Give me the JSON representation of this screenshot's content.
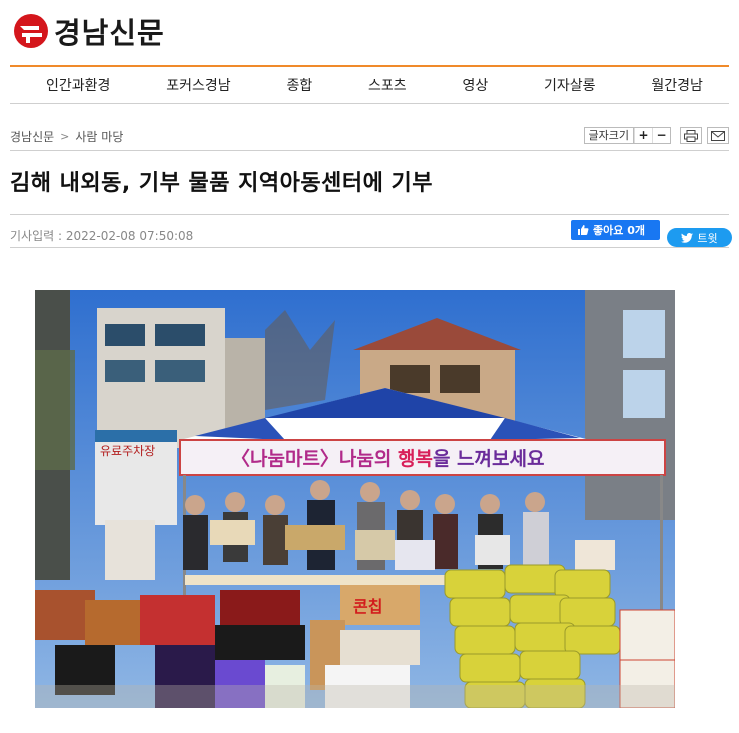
{
  "site": {
    "logo_text": "경남신문"
  },
  "nav": {
    "items": [
      "인간과환경",
      "포커스경남",
      "종합",
      "스포츠",
      "영상",
      "기자살롱",
      "월간경남"
    ]
  },
  "breadcrumb": {
    "home": "경남신문",
    "separator": ">",
    "section": "사람 마당"
  },
  "tools": {
    "font_size_label": "글자크기",
    "plus": "+",
    "minus": "−"
  },
  "article": {
    "title": "김해 내외동, 기부 물품 지역아동센터에 기부",
    "date_label": "기사입력 : 2022-02-08 07:50:08"
  },
  "social": {
    "like_label": "좋아요 0개",
    "tweet_label": "트윗"
  },
  "photo": {
    "banner_text_part1": "〈나눔마트〉나눔의 ",
    "banner_text_part2": "행복",
    "banner_text_part3": "을 느껴보세요",
    "sign_parking": "유료주차장",
    "box_label": "콘칩",
    "colors": {
      "sky": "#3f7bd0",
      "tent_blue": "#2f4fb0",
      "banner_pink": "#d8327a",
      "rice_bag": "#d8d23a"
    }
  }
}
